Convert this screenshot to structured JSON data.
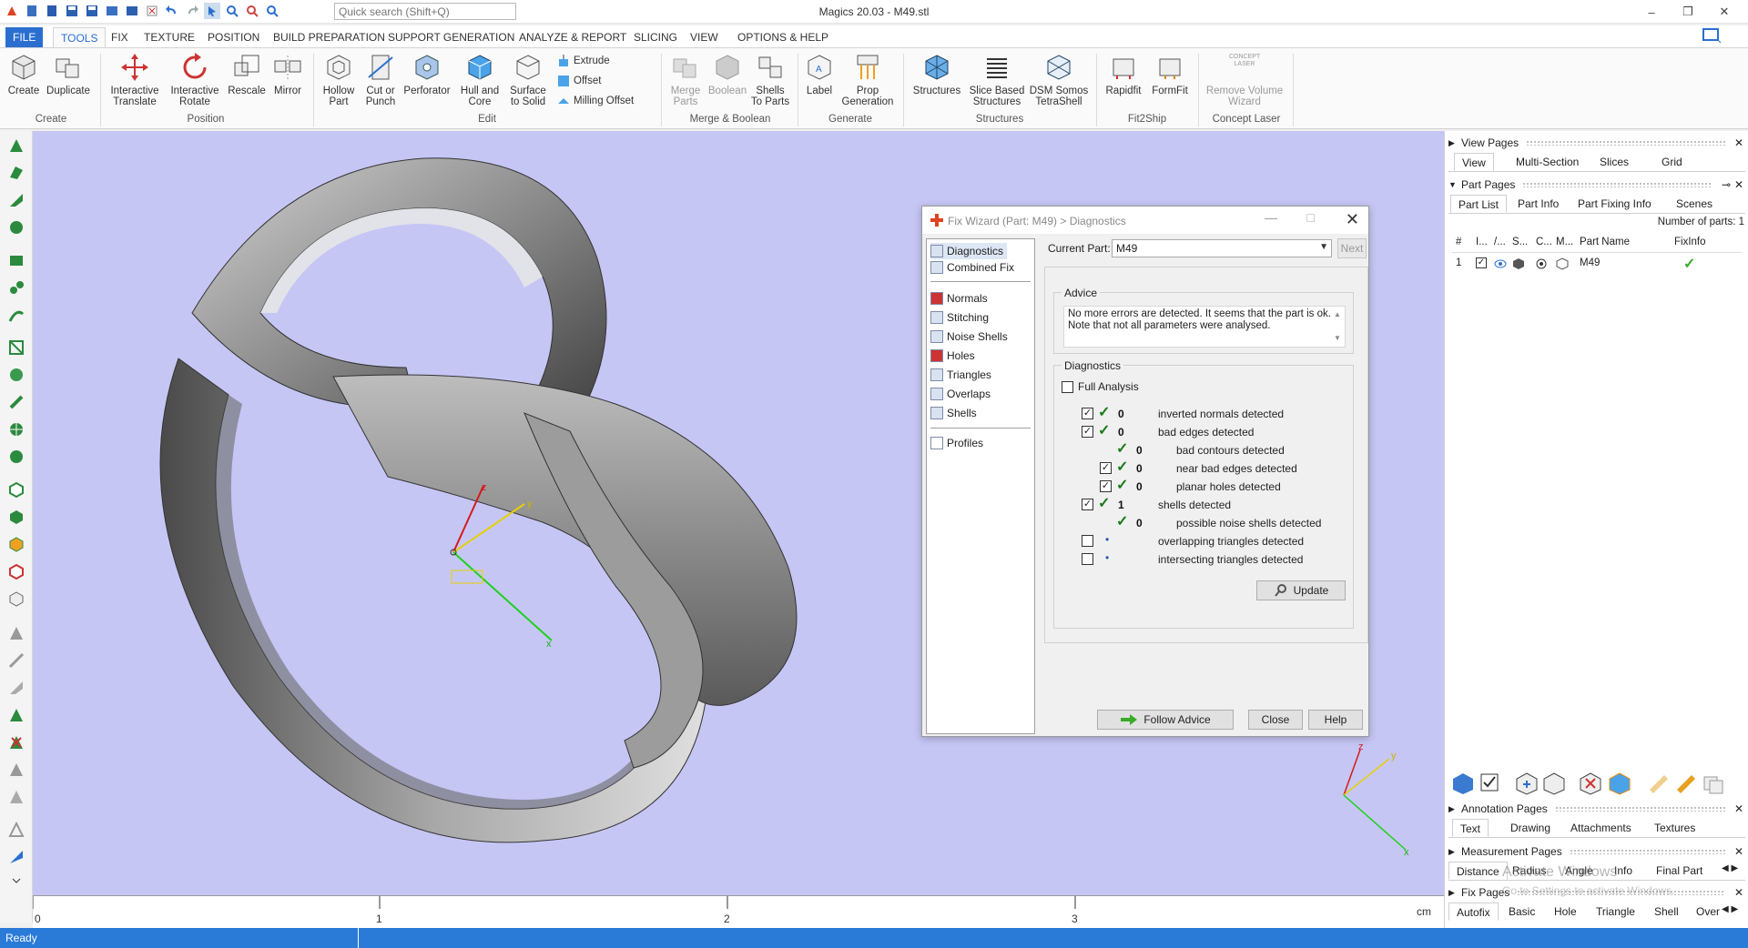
{
  "window": {
    "title": "Magics 20.03 - M49.stl",
    "search_placeholder": "Quick search (Shift+Q)",
    "controls": [
      "–",
      "❐",
      "✕"
    ]
  },
  "ribbon_tabs": [
    "FILE",
    "TOOLS",
    "FIX",
    "TEXTURE",
    "POSITION",
    "BUILD PREPARATION",
    "SUPPORT GENERATION",
    "ANALYZE & REPORT",
    "SLICING",
    "VIEW",
    "OPTIONS & HELP"
  ],
  "ribbon": {
    "create": {
      "create": "Create",
      "duplicate": "Duplicate",
      "group": "Create"
    },
    "position": {
      "translate": "Interactive Translate",
      "rotate": "Interactive Rotate",
      "rescale": "Rescale",
      "mirror": "Mirror",
      "group": "Position"
    },
    "edit": {
      "hollow": "Hollow Part",
      "cut": "Cut or Punch",
      "perforator": "Perforator",
      "hull": "Hull and Core",
      "surface": "Surface to Solid",
      "extrude": "Extrude",
      "offset": "Offset",
      "milling": "Milling Offset",
      "group": "Edit"
    },
    "merge": {
      "merge": "Merge Parts",
      "boolean": "Boolean",
      "shells": "Shells To Parts",
      "group": "Merge & Boolean"
    },
    "generate": {
      "label": "Label",
      "prop": "Prop Generation",
      "group": "Generate"
    },
    "structures": {
      "structures": "Structures",
      "slice": "Slice Based Structures",
      "dsm": "DSM Somos TetraShell",
      "group": "Structures"
    },
    "fit2ship": {
      "rapidfit": "Rapidfit",
      "formfit": "FormFit",
      "group": "Fit2Ship"
    },
    "concept": {
      "remove": "Remove Volume Wizard",
      "group": "Concept Laser",
      "logo": "CONCEPT LASER"
    }
  },
  "dialog": {
    "title": "Fix Wizard (Part: M49) > Diagnostics",
    "nav_top": [
      "Diagnostics",
      "Combined Fix"
    ],
    "nav_mid": [
      "Normals",
      "Stitching",
      "Noise Shells",
      "Holes",
      "Triangles",
      "Overlaps",
      "Shells"
    ],
    "nav_bottom": [
      "Profiles"
    ],
    "current_part_label": "Current Part:",
    "current_part_value": "M49",
    "next_label": "Next",
    "advice_title": "Advice",
    "advice_text": "No more errors are detected. It seems that the part is ok. Note that not all parameters were analysed.",
    "diag_title": "Diagnostics",
    "full_analysis": "Full Analysis",
    "rows": [
      {
        "count": "0",
        "text": "inverted normals detected"
      },
      {
        "count": "0",
        "text": "bad edges detected"
      },
      {
        "count": "0",
        "text": "bad contours detected"
      },
      {
        "count": "0",
        "text": "near bad edges detected"
      },
      {
        "count": "0",
        "text": "planar holes detected"
      },
      {
        "count": "1",
        "text": "shells detected"
      },
      {
        "count": "0",
        "text": "possible noise shells detected"
      },
      {
        "count": "•",
        "text": "overlapping triangles detected"
      },
      {
        "count": "•",
        "text": "intersecting triangles detected"
      }
    ],
    "update_label": "Update",
    "follow_label": "Follow Advice",
    "close_label": "Close",
    "help_label": "Help"
  },
  "viewport": {
    "ruler": [
      "0",
      "1",
      "2",
      "3"
    ],
    "unit": "cm",
    "axes": {
      "x": "x",
      "y": "y",
      "z": "z"
    }
  },
  "status": {
    "text": "Ready"
  },
  "right_panel": {
    "view_pages": "View Pages",
    "view_tabs": [
      "View",
      "Multi-Section",
      "Slices",
      "Grid"
    ],
    "part_pages": "Part Pages",
    "part_tabs": [
      "Part List",
      "Part Info",
      "Part Fixing Info",
      "Scenes"
    ],
    "number_of_parts": "Number of parts: 1",
    "columns": [
      "#",
      "I...",
      "/...",
      "S...",
      "C...",
      "M...",
      "Part Name",
      "FixInfo"
    ],
    "row": {
      "index": "1",
      "name": "M49"
    },
    "annotation_pages": "Annotation Pages",
    "annotation_tabs": [
      "Text",
      "Drawing",
      "Attachments",
      "Textures"
    ],
    "measurement_pages": "Measurement Pages",
    "measurement_tabs": [
      "Distance",
      "Radius",
      "Angle",
      "Info",
      "Final Part"
    ],
    "fix_pages": "Fix Pages",
    "fix_tabs": [
      "Autofix",
      "Basic",
      "Hole",
      "Triangle",
      "Shell",
      "Over"
    ],
    "watermark": "Activate Windows",
    "watermark_sub": "Go to Settings to activate Windows."
  },
  "colors": {
    "accent": "#2a6fd0",
    "viewport": "#c6c6f5",
    "status": "#2a7ad8",
    "check": "#1a7a1a"
  }
}
